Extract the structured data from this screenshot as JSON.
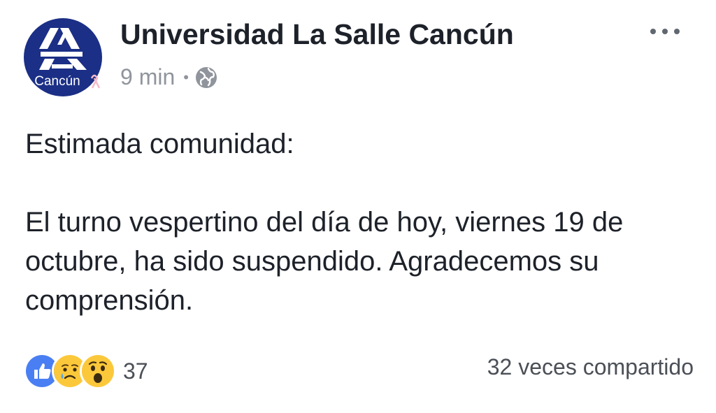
{
  "post": {
    "page_name": "Universidad La Salle Cancún",
    "time": "9 min",
    "separator": "•",
    "privacy_icon": "globe-icon",
    "more_icon": "more-options-icon",
    "avatar": {
      "label": "Cancún",
      "bg_color": "#1b2f86",
      "fg_color": "#ffffff",
      "ribbon_color": "#f5b9c8"
    },
    "body": {
      "greeting": "Estimada comunidad:",
      "message": "El turno vespertino del día de hoy, viernes 19 de octubre, ha sido suspendido. Agradecemos su comprensión."
    },
    "reactions": {
      "icons": [
        "like-icon",
        "sad-icon",
        "wow-icon"
      ],
      "count": "37"
    },
    "shares": "32 veces compartido",
    "colors": {
      "like_blue": "#4a7ff3",
      "emoji_yellow": "#fcc83b",
      "meta_gray": "#90949c"
    }
  }
}
